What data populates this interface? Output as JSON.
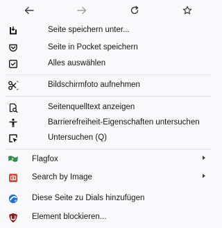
{
  "nav": {
    "back_icon": "arrow-left-icon",
    "forward_icon": "arrow-right-icon",
    "reload_icon": "reload-icon",
    "bookmark_icon": "star-icon"
  },
  "items": [
    {
      "label": "Seite speichern unter...",
      "icon": "save-page-icon"
    },
    {
      "label": "Seite in Pocket speichern",
      "icon": "pocket-icon"
    },
    {
      "label": "Alles auswählen",
      "icon": "select-all-icon"
    },
    {
      "label": "Bildschirmfoto aufnehmen",
      "icon": "screenshot-scissors-icon"
    },
    {
      "label": "Seitenquelltext anzeigen",
      "icon": "view-source-icon"
    },
    {
      "label": "Barrierefreiheit-Eigenschaften untersuchen",
      "icon": "accessibility-icon"
    },
    {
      "label": "Untersuchen (Q)",
      "icon": "inspect-icon"
    },
    {
      "label": "Flagfox",
      "icon": "flagfox-icon",
      "submenu": true
    },
    {
      "label": "Search by Image",
      "icon": "search-by-image-icon",
      "submenu": true
    },
    {
      "label": "Diese Seite zu Dials hinzufügen",
      "icon": "dials-icon"
    },
    {
      "label": "Element blockieren...",
      "icon": "ublock-icon"
    }
  ],
  "colors": {
    "flagfox": "#2e8b57",
    "search_by_image": "#e0453a",
    "dials": "#1f6fd6",
    "ublock": "#8b1a1a"
  }
}
